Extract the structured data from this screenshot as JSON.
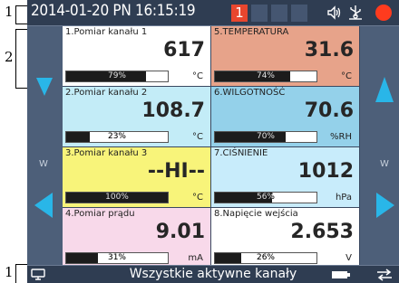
{
  "callouts": {
    "top": "1",
    "side": "2",
    "bottom": "1"
  },
  "status": {
    "datetime": "2014-01-20 PN 16:15:19",
    "screen_number": "1"
  },
  "side_labels": {
    "left_w": "W",
    "right_w": "W"
  },
  "tiles": [
    {
      "title": "1.Pomiar kanału 1",
      "value": "617",
      "unit": "°C",
      "bar_label": "79%",
      "bar_level": 0.79,
      "bg": "#ffffff"
    },
    {
      "title": "2.Pomiar kanału 2",
      "value": "108.7",
      "unit": "°C",
      "bar_label": "23%",
      "bar_level": 0.23,
      "bg": "#c3ecf7"
    },
    {
      "title": "3.Pomiar kanału 3",
      "value": "--HI--",
      "unit": "°C",
      "bar_label": "100%",
      "bar_level": 1.0,
      "bg": "#f8f47a"
    },
    {
      "title": "4.Pomiar prądu",
      "value": "9.01",
      "unit": "mA",
      "bar_label": "31%",
      "bar_level": 0.31,
      "bg": "#f8d9ea"
    },
    {
      "title": "5.TEMPERATURA",
      "value": "31.6",
      "unit": "°C",
      "bar_label": "74%",
      "bar_level": 0.74,
      "bg": "#e7a38a"
    },
    {
      "title": "6.WILGOTNOŚĆ",
      "value": "70.6",
      "unit": "%RH",
      "bar_label": "70%",
      "bar_level": 0.7,
      "bg": "#94d1ea"
    },
    {
      "title": "7.CIŚNIENIE",
      "value": "1012",
      "unit": "hPa",
      "bar_label": "56%",
      "bar_level": 0.56,
      "bg": "#c8ecfb"
    },
    {
      "title": "8.Napięcie wejścia",
      "value": "2.653",
      "unit": "V",
      "bar_label": "26%",
      "bar_level": 0.26,
      "bg": "#ffffff"
    }
  ],
  "bottom": {
    "label": "Wszystkie aktywne kanały"
  },
  "colors": {
    "accent_arrow": "#29b6e8",
    "record": "#ff3b1e",
    "screen_badge": "#e8462e"
  }
}
